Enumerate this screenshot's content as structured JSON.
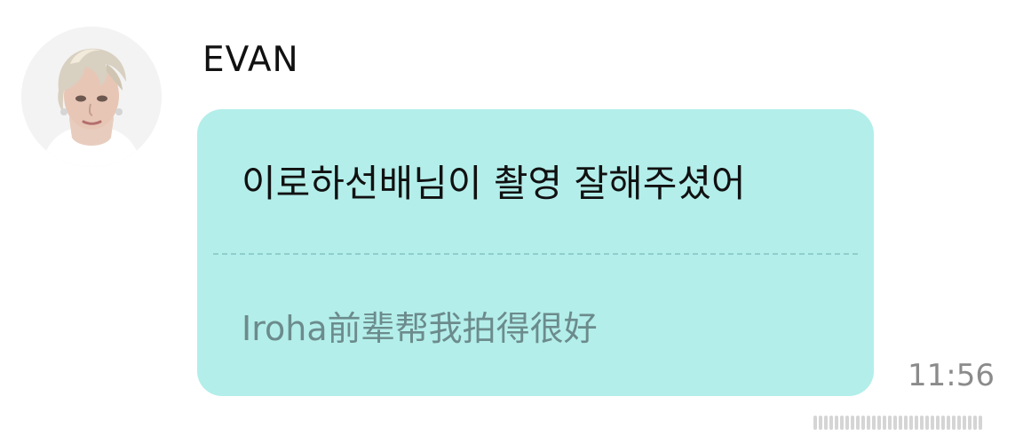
{
  "chat": {
    "sender": {
      "name": "EVAN",
      "avatar_icon": "user-avatar-photo"
    },
    "message": {
      "original_text": "이로하선배님이 촬영 잘해주셨어",
      "translation_text": "Iroha前辈帮我拍得很好",
      "time": "11:56"
    }
  },
  "colors": {
    "bubble_background": "#b3eeea",
    "text_primary": "#111111",
    "translation_text": "#6c8b8c",
    "timestamp": "#8b8b8b",
    "divider": "#8fcfcb"
  }
}
